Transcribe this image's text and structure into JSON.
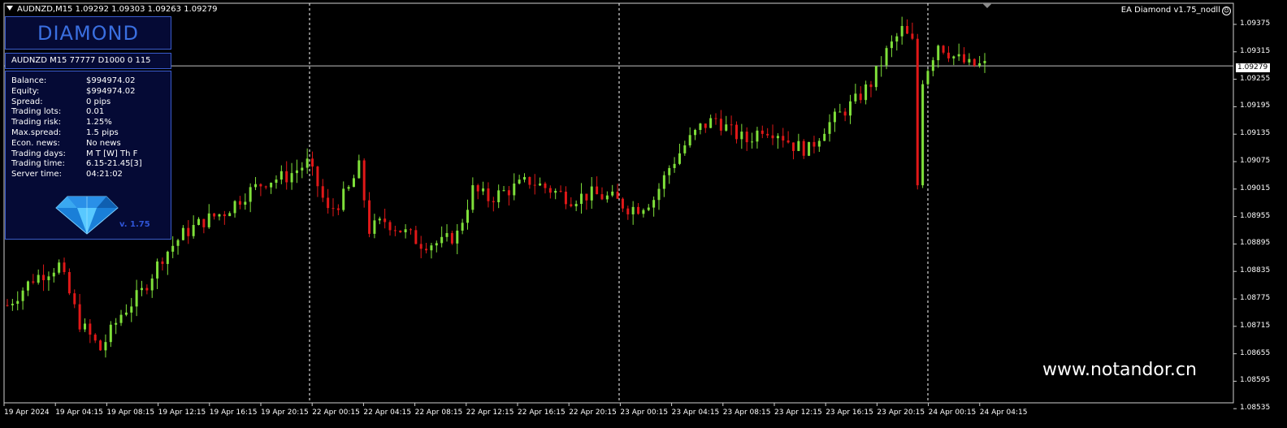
{
  "header": {
    "symbol_line": "AUDNZD,M15  1.09292 1.09303 1.09263 1.09279",
    "ea_label": "EA Diamond v1.75_nodll",
    "ea_icon": "smiley-icon"
  },
  "panel": {
    "logo": "DIAMOND",
    "id_line": "AUDNZD M15 77777  D1000 0 115",
    "rows": [
      {
        "key": "Balance:",
        "value": "$994974.02"
      },
      {
        "key": "Equity:",
        "value": "$994974.02"
      },
      {
        "key": "Spread:",
        "value": "0 pips"
      },
      {
        "key": "Trading lots:",
        "value": "0.01"
      },
      {
        "key": "Trading risk:",
        "value": "1.25%"
      },
      {
        "key": "Max.spread:",
        "value": "1.5 pips"
      },
      {
        "key": "Econ. news:",
        "value": "No news"
      },
      {
        "key": "Trading days:",
        "value": "M T [W] Th F"
      },
      {
        "key": "Trading time:",
        "value": "6.15-21.45[3]"
      },
      {
        "key": "Server time:",
        "value": "04:21:02"
      }
    ],
    "version": "v. 1.75",
    "gem_icon": "diamond-gem-icon"
  },
  "watermark": "www.notandor.cn",
  "current_price": "1.09279",
  "colors": {
    "bull": "#7fe03a",
    "bear": "#e01818",
    "panel_border": "#3a5ccc",
    "panel_bg": "#050a35"
  },
  "y_axis": [
    "1.09375",
    "1.09315",
    "1.09255",
    "1.09195",
    "1.09135",
    "1.09075",
    "1.09015",
    "1.08955",
    "1.08895",
    "1.08835",
    "1.08775",
    "1.08715",
    "1.08655",
    "1.08595",
    "1.08535"
  ],
  "x_axis": [
    "19 Apr 2024",
    "19 Apr 04:15",
    "19 Apr 08:15",
    "19 Apr 12:15",
    "19 Apr 16:15",
    "19 Apr 20:15",
    "22 Apr 00:15",
    "22 Apr 04:15",
    "22 Apr 08:15",
    "22 Apr 12:15",
    "22 Apr 16:15",
    "22 Apr 20:15",
    "23 Apr 00:15",
    "23 Apr 04:15",
    "23 Apr 08:15",
    "23 Apr 12:15",
    "23 Apr 16:15",
    "23 Apr 20:15",
    "24 Apr 00:15",
    "24 Apr 04:15"
  ],
  "chart_data": {
    "type": "candlestick",
    "symbol": "AUDNZD",
    "timeframe": "M15",
    "ylim": [
      1.0852,
      1.0942
    ],
    "current_price": 1.09279,
    "close_path": [
      [
        0,
        1.0874
      ],
      [
        5,
        1.088
      ],
      [
        10,
        1.0883
      ],
      [
        14,
        1.087
      ],
      [
        18,
        1.0864
      ],
      [
        22,
        1.0872
      ],
      [
        26,
        1.0877
      ],
      [
        30,
        1.0885
      ],
      [
        34,
        1.089
      ],
      [
        38,
        1.0893
      ],
      [
        42,
        1.0895
      ],
      [
        46,
        1.0899
      ],
      [
        50,
        1.0902
      ],
      [
        54,
        1.0903
      ],
      [
        58,
        1.0906
      ],
      [
        60,
        1.0901
      ],
      [
        62,
        1.0895
      ],
      [
        64,
        1.0897
      ],
      [
        66,
        1.09
      ],
      [
        68,
        1.0905
      ],
      [
        70,
        1.0891
      ],
      [
        73,
        1.0893
      ],
      [
        76,
        1.0891
      ],
      [
        80,
        1.0888
      ],
      [
        84,
        1.0888
      ],
      [
        87,
        1.089
      ],
      [
        90,
        1.09
      ],
      [
        93,
        1.0898
      ],
      [
        97,
        1.09
      ],
      [
        101,
        1.0902
      ],
      [
        105,
        1.09
      ],
      [
        109,
        1.0898
      ],
      [
        113,
        1.0899
      ],
      [
        117,
        1.0898
      ],
      [
        120,
        1.0896
      ],
      [
        122,
        1.0896
      ],
      [
        125,
        1.0898
      ],
      [
        128,
        1.0905
      ],
      [
        131,
        1.091
      ],
      [
        134,
        1.0914
      ],
      [
        137,
        1.0916
      ],
      [
        140,
        1.0913
      ],
      [
        143,
        1.0911
      ],
      [
        146,
        1.0914
      ],
      [
        149,
        1.0913
      ],
      [
        152,
        1.091
      ],
      [
        155,
        1.0909
      ],
      [
        158,
        1.0914
      ],
      [
        161,
        1.0917
      ],
      [
        164,
        1.092
      ],
      [
        167,
        1.0924
      ],
      [
        170,
        1.0931
      ],
      [
        173,
        1.0936
      ],
      [
        175,
        1.0933
      ],
      [
        176,
        1.0902
      ],
      [
        177,
        1.0925
      ],
      [
        180,
        1.0933
      ],
      [
        183,
        1.093
      ],
      [
        186,
        1.0928
      ],
      [
        189,
        1.0928
      ]
    ]
  }
}
